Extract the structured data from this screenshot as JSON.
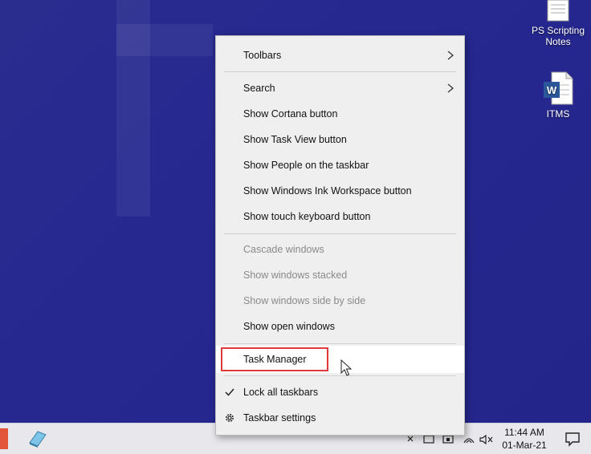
{
  "desktop": {
    "icons": [
      {
        "label_line1": "PS Scripting",
        "label_line2": "Notes"
      },
      {
        "label_line1": "ITMS",
        "label_line2": ""
      }
    ]
  },
  "menu": {
    "items": [
      {
        "label": "Toolbars"
      },
      {
        "label": "Search"
      },
      {
        "label": "Show Cortana button"
      },
      {
        "label": "Show Task View button"
      },
      {
        "label": "Show People on the taskbar"
      },
      {
        "label": "Show Windows Ink Workspace button"
      },
      {
        "label": "Show touch keyboard button"
      },
      {
        "label": "Cascade windows"
      },
      {
        "label": "Show windows stacked"
      },
      {
        "label": "Show windows side by side"
      },
      {
        "label": "Show open windows"
      },
      {
        "label": "Task Manager"
      },
      {
        "label": "Lock all taskbars"
      },
      {
        "label": "Taskbar settings"
      }
    ]
  },
  "taskbar": {
    "time": "11:44 AM",
    "date": "01-Mar-21"
  },
  "colors": {
    "highlight_border": "#e03b3b",
    "desktop_bg": "#262890"
  }
}
